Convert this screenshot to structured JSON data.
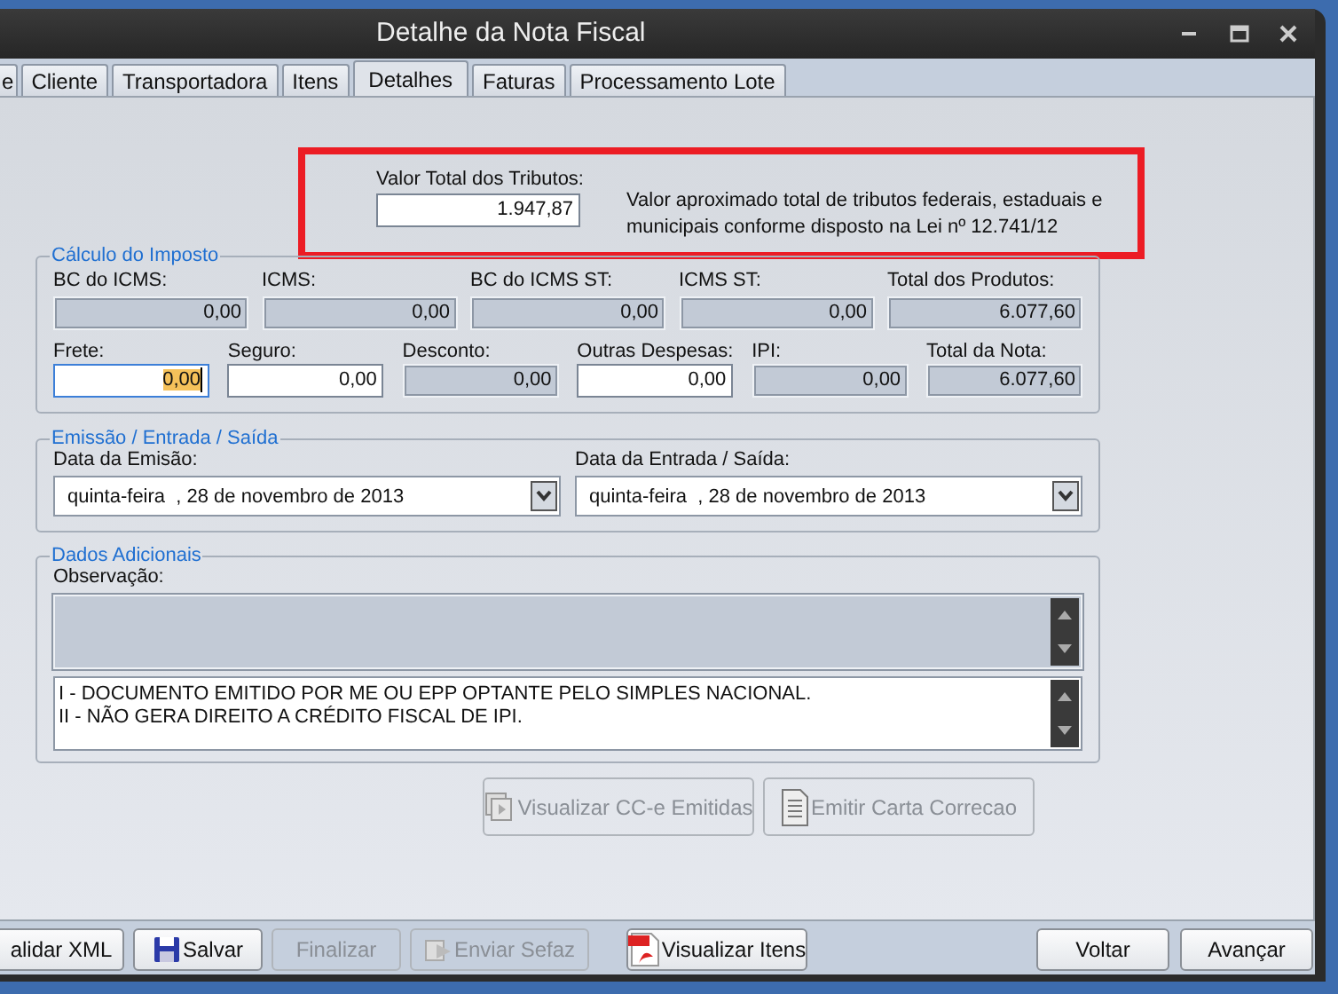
{
  "window": {
    "title": "Detalhe da Nota Fiscal"
  },
  "tabs": [
    {
      "label": "e",
      "selected": false
    },
    {
      "label": "Cliente",
      "selected": false
    },
    {
      "label": "Transportadora",
      "selected": false
    },
    {
      "label": "Itens",
      "selected": false
    },
    {
      "label": "Detalhes",
      "selected": true
    },
    {
      "label": "Faturas",
      "selected": false
    },
    {
      "label": "Processamento Lote",
      "selected": false
    }
  ],
  "tributos": {
    "label": "Valor Total dos Tributos:",
    "value": "1.947,87",
    "note": "Valor aproximado total de tributos federais, estaduais e municipais conforme disposto na Lei nº 12.741/12",
    "highlighted": true
  },
  "calculo": {
    "title": "Cálculo do Imposto",
    "top_fields": [
      {
        "label": "BC do ICMS:",
        "value": "0,00",
        "editable": false,
        "focused": false
      },
      {
        "label": "ICMS:",
        "value": "0,00",
        "editable": false,
        "focused": false
      },
      {
        "label": "BC do ICMS ST:",
        "value": "0,00",
        "editable": false,
        "focused": false
      },
      {
        "label": "ICMS ST:",
        "value": "0,00",
        "editable": false,
        "focused": false
      },
      {
        "label": "Total dos Produtos:",
        "value": "6.077,60",
        "editable": false,
        "focused": false
      }
    ],
    "bottom_fields": [
      {
        "label": "Frete:",
        "value": "0,00",
        "editable": true,
        "focused": true
      },
      {
        "label": "Seguro:",
        "value": "0,00",
        "editable": true,
        "focused": false
      },
      {
        "label": "Desconto:",
        "value": "0,00",
        "editable": false,
        "focused": false
      },
      {
        "label": "Outras Despesas:",
        "value": "0,00",
        "editable": true,
        "focused": false
      },
      {
        "label": "IPI:",
        "value": "0,00",
        "editable": false,
        "focused": false
      },
      {
        "label": "Total da Nota:",
        "value": "6.077,60",
        "editable": false,
        "focused": false
      }
    ]
  },
  "datas": {
    "title": "Emissão / Entrada / Saída",
    "fields": [
      {
        "label": "Data da Emisão:",
        "value": "quinta-feira  , 28 de novembro de 2013"
      },
      {
        "label": "Data da Entrada / Saída:",
        "value": "quinta-feira  , 28 de novembro de 2013"
      }
    ]
  },
  "adicionais": {
    "title": "Dados Adicionais",
    "label": "Observação:",
    "boxes": [
      {
        "editable": false
      },
      {
        "lines": [
          "I - DOCUMENTO EMITIDO POR ME OU EPP OPTANTE PELO SIMPLES NACIONAL.",
          "II - NÃO GERA DIREITO A CRÉDITO FISCAL DE IPI."
        ],
        "editable": true
      }
    ]
  },
  "cce_buttons": [
    {
      "label": "Visualizar CC-e Emitidas",
      "disabled": true
    },
    {
      "label": "Emitir Carta Correcao",
      "disabled": true
    }
  ],
  "bottom_buttons": {
    "actions": [
      {
        "label": "alidar XML",
        "disabled": false
      },
      {
        "label": "Salvar",
        "disabled": false
      },
      {
        "label": "Finalizar",
        "disabled": true
      },
      {
        "label": "Enviar Sefaz",
        "disabled": true
      }
    ],
    "view": [
      {
        "label": "Visualizar Itens",
        "disabled": false
      }
    ],
    "navigation": [
      {
        "label": "Voltar",
        "disabled": false
      },
      {
        "label": "Avançar",
        "disabled": false
      }
    ]
  }
}
